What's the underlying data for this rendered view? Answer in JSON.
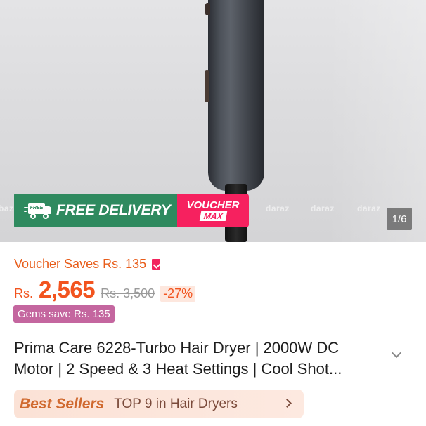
{
  "gallery": {
    "watermarks": [
      "bazar",
      "zar",
      "daraz",
      "daraz",
      "daraz"
    ],
    "promo": {
      "truck_label": "FREE",
      "delivery_text": "FREE DELIVERY",
      "voucher_top": "VOUCHER",
      "voucher_max": "MAX"
    },
    "counter": "1/6"
  },
  "voucher_saves": {
    "text": "Voucher Saves Rs. 135",
    "icon": "voucher-tag-icon"
  },
  "price": {
    "currency": "Rs.",
    "value": "2,565",
    "original": "Rs. 3,500",
    "discount": "-27%"
  },
  "gems": {
    "text": "Gems save Rs. 135"
  },
  "product": {
    "title": "Prima Care 6228-Turbo Hair Dryer | 2000W DC Motor | 2 Speed & 3 Heat Settings | Cool Shot..."
  },
  "best_sellers": {
    "label": "Best Sellers",
    "rank": "TOP 9 in Hair Dryers"
  },
  "colors": {
    "accent_orange": "#f2541f",
    "voucher_text": "#e85d1a",
    "free_delivery_green": "#2f8a5f",
    "voucher_pink": "#f6215f",
    "gems_purple": "#c4669f"
  }
}
